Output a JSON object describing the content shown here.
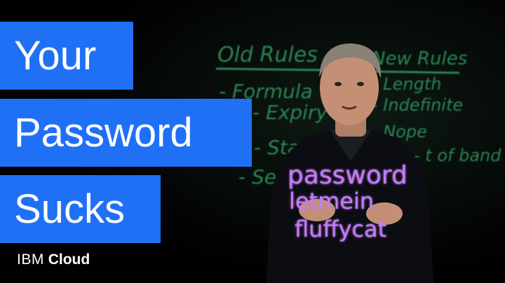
{
  "title_lines": [
    "Your",
    "Password",
    "Sucks"
  ],
  "brand": {
    "company": "IBM",
    "product": "Cloud"
  },
  "lightboard": {
    "heading_left": "Old Rules",
    "heading_right": "New Rules",
    "left_items": [
      "- Formula",
      "- Expiry",
      "- Stat",
      "- Se"
    ],
    "right_items": [
      "- Length",
      "- Indefinite",
      "- Nope",
      "- t of band"
    ],
    "example_passwords": [
      "password",
      "letmein",
      "fluffycat"
    ]
  },
  "colors": {
    "title_background": "#1f70f5",
    "title_text": "#ffffff",
    "board_green": "#2f9a5f",
    "marker_purple": "#c57cf5"
  }
}
